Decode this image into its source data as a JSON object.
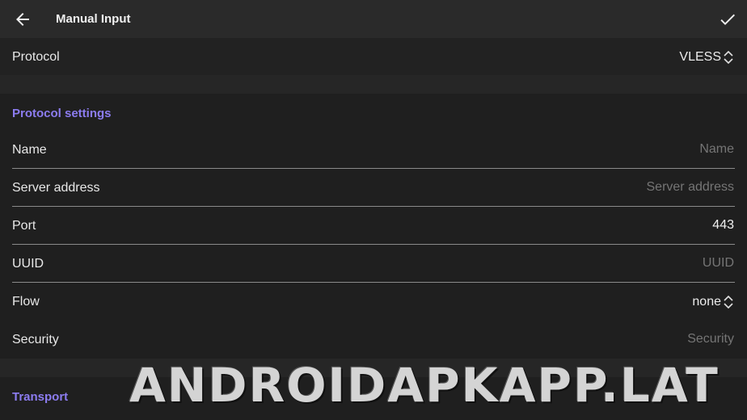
{
  "app_bar": {
    "title": "Manual Input",
    "back_icon": "arrow-left-icon",
    "confirm_icon": "check-icon"
  },
  "protocol": {
    "label": "Protocol",
    "value": "VLESS"
  },
  "protocol_settings": {
    "title": "Protocol settings",
    "fields": {
      "name": {
        "label": "Name",
        "placeholder": "Name",
        "value": ""
      },
      "server_address": {
        "label": "Server address",
        "placeholder": "Server address",
        "value": ""
      },
      "port": {
        "label": "Port",
        "placeholder": "",
        "value": "443"
      },
      "uuid": {
        "label": "UUID",
        "placeholder": "UUID",
        "value": ""
      },
      "flow": {
        "label": "Flow",
        "value": "none"
      },
      "security": {
        "label": "Security",
        "placeholder": "Security",
        "value": ""
      }
    }
  },
  "transport": {
    "title": "Transport"
  },
  "watermark": "ANDROIDAPKAPP.LAT",
  "colors": {
    "accent": "#8c7cf0",
    "background": "#1f1f1f",
    "app_bar": "#2a2a2a"
  }
}
